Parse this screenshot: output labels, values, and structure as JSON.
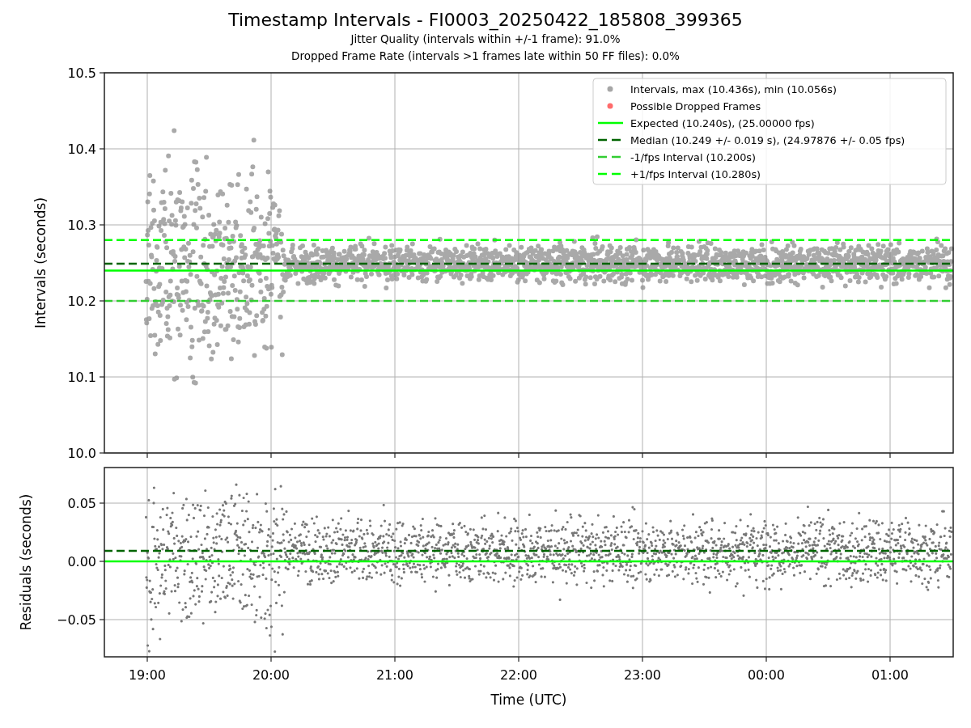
{
  "figure": {
    "title": "Timestamp Intervals - FI0003_20250422_185808_399365",
    "subtitles": [
      "Jitter Quality (intervals within +/-1 frame): 91.0%",
      "Dropped Frame Rate (intervals >1 frames late within 50 FF files): 0.0%"
    ]
  },
  "intervals_panel": {
    "ylabel": "Intervals (seconds)",
    "yticks": [
      "10.5",
      "10.4",
      "10.3",
      "10.2",
      "10.1",
      "10.0"
    ],
    "legend": [
      {
        "kind": "point",
        "color": "#a6a6a6",
        "label": "Intervals, max (10.436s), min (10.056s)"
      },
      {
        "kind": "point",
        "color": "#ff6b6b",
        "label": "Possible Dropped Frames"
      },
      {
        "kind": "solid-line",
        "color": "#00ff00",
        "label": "Expected (10.240s), (25.00000 fps)"
      },
      {
        "kind": "dashed-line",
        "color": "#006400",
        "label": "Median (10.249 +/- 0.019 s), (24.97876 +/- 0.05 fps)"
      },
      {
        "kind": "dashed-line",
        "color": "#32cd32",
        "label": "-1/fps Interval (10.200s)"
      },
      {
        "kind": "dashed-line",
        "color": "#00ff00",
        "label": "+1/fps Interval (10.280s)"
      }
    ]
  },
  "residuals_panel": {
    "ylabel": "Residuals (seconds)",
    "yticks": [
      "0.05",
      "0.00",
      "−0.05"
    ],
    "xticks": [
      "19:00",
      "20:00",
      "21:00",
      "22:00",
      "23:00",
      "00:00",
      "01:00"
    ],
    "xlabel": "Time (UTC)"
  }
}
